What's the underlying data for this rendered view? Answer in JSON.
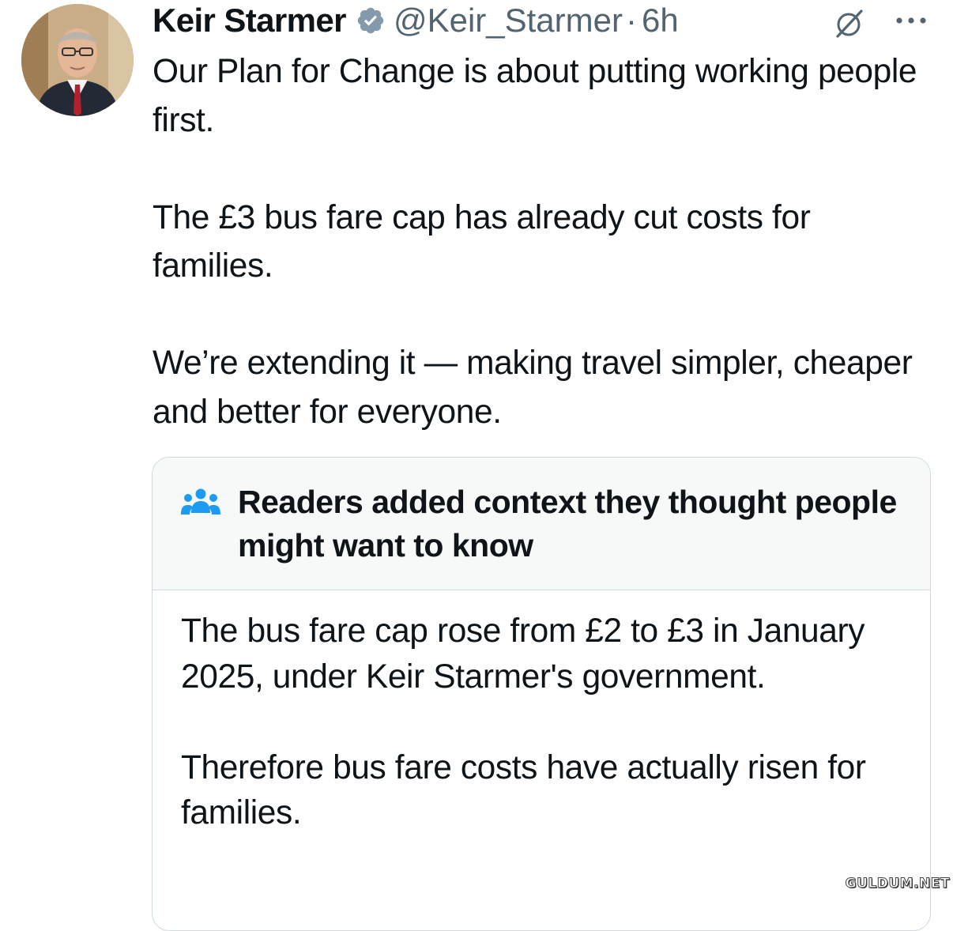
{
  "tweet": {
    "author_name": "Keir Starmer",
    "handle": "@Keir_Starmer",
    "separator": "·",
    "time": "6h",
    "paragraphs": [
      "Our Plan for Change is about putting working people first.",
      "The £3 bus fare cap has already cut costs for families.",
      "We’re extending it — making travel simpler, cheaper and better for everyone."
    ]
  },
  "community_note": {
    "title": "Readers added context they thought people might want to know",
    "paragraphs": [
      "The bus fare cap rose from £2 to £3 in January 2025, under Keir Starmer's government.",
      "Therefore bus fare costs have actually risen for families."
    ]
  },
  "watermark": "GULDUM.NET",
  "colors": {
    "text": "#0f1419",
    "secondary_text": "#536471",
    "verified_badge": "#829aab",
    "community_icon": "#1d9bf0",
    "note_header_bg": "#f7f9f9",
    "border": "#cfd9de"
  },
  "icons": {
    "verified": "verified-badge-icon",
    "grok": "grok-icon",
    "more": "more-options-icon",
    "community": "people-icon"
  }
}
